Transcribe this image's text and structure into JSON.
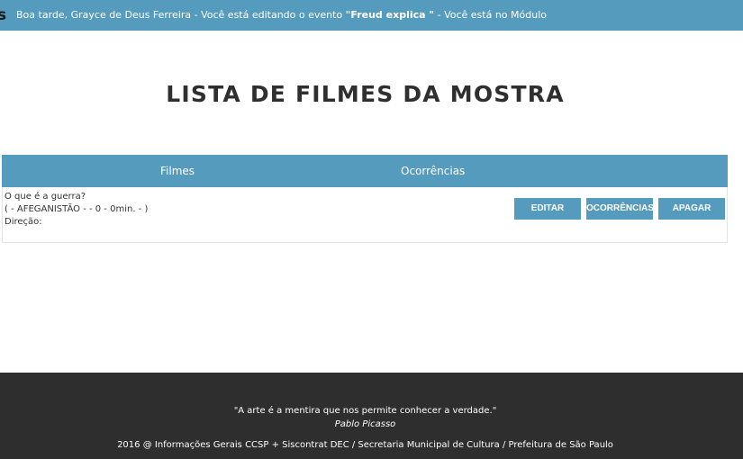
{
  "topbar": {
    "logo_fragment": "s",
    "greeting_before": "Boa tarde, Grayce de Deus Ferreira - Você está editando o evento ",
    "event_name": "\"Freud explica \"",
    "greeting_after": " - Você está no Módulo"
  },
  "page": {
    "title": "LISTA DE FILMES DA MOSTRA"
  },
  "table": {
    "headers": {
      "films": "Filmes",
      "occurrences": "Ocorrências"
    },
    "rows": [
      {
        "title": "O que é a guerra?",
        "details": "( - AFEGANISTÃO - - 0 - 0min. - )",
        "direction": "Direção:",
        "actions": {
          "edit": "EDITAR",
          "occurrences": "OCORRÊNCIAS",
          "delete": "APAGAR"
        }
      }
    ]
  },
  "footer": {
    "quote": "\"A arte é a mentira que nos permite conhecer a verdade.\"",
    "author": "Pablo Picasso",
    "copyright": "2016 @ Informações Gerais CCSP + Siscontrat DEC / Secretaria Municipal de Cultura / Prefeitura de São Paulo"
  },
  "colors": {
    "accent": "#559bbd",
    "footer_bg": "#2e2e2e",
    "title_text": "#2f2f2f"
  }
}
